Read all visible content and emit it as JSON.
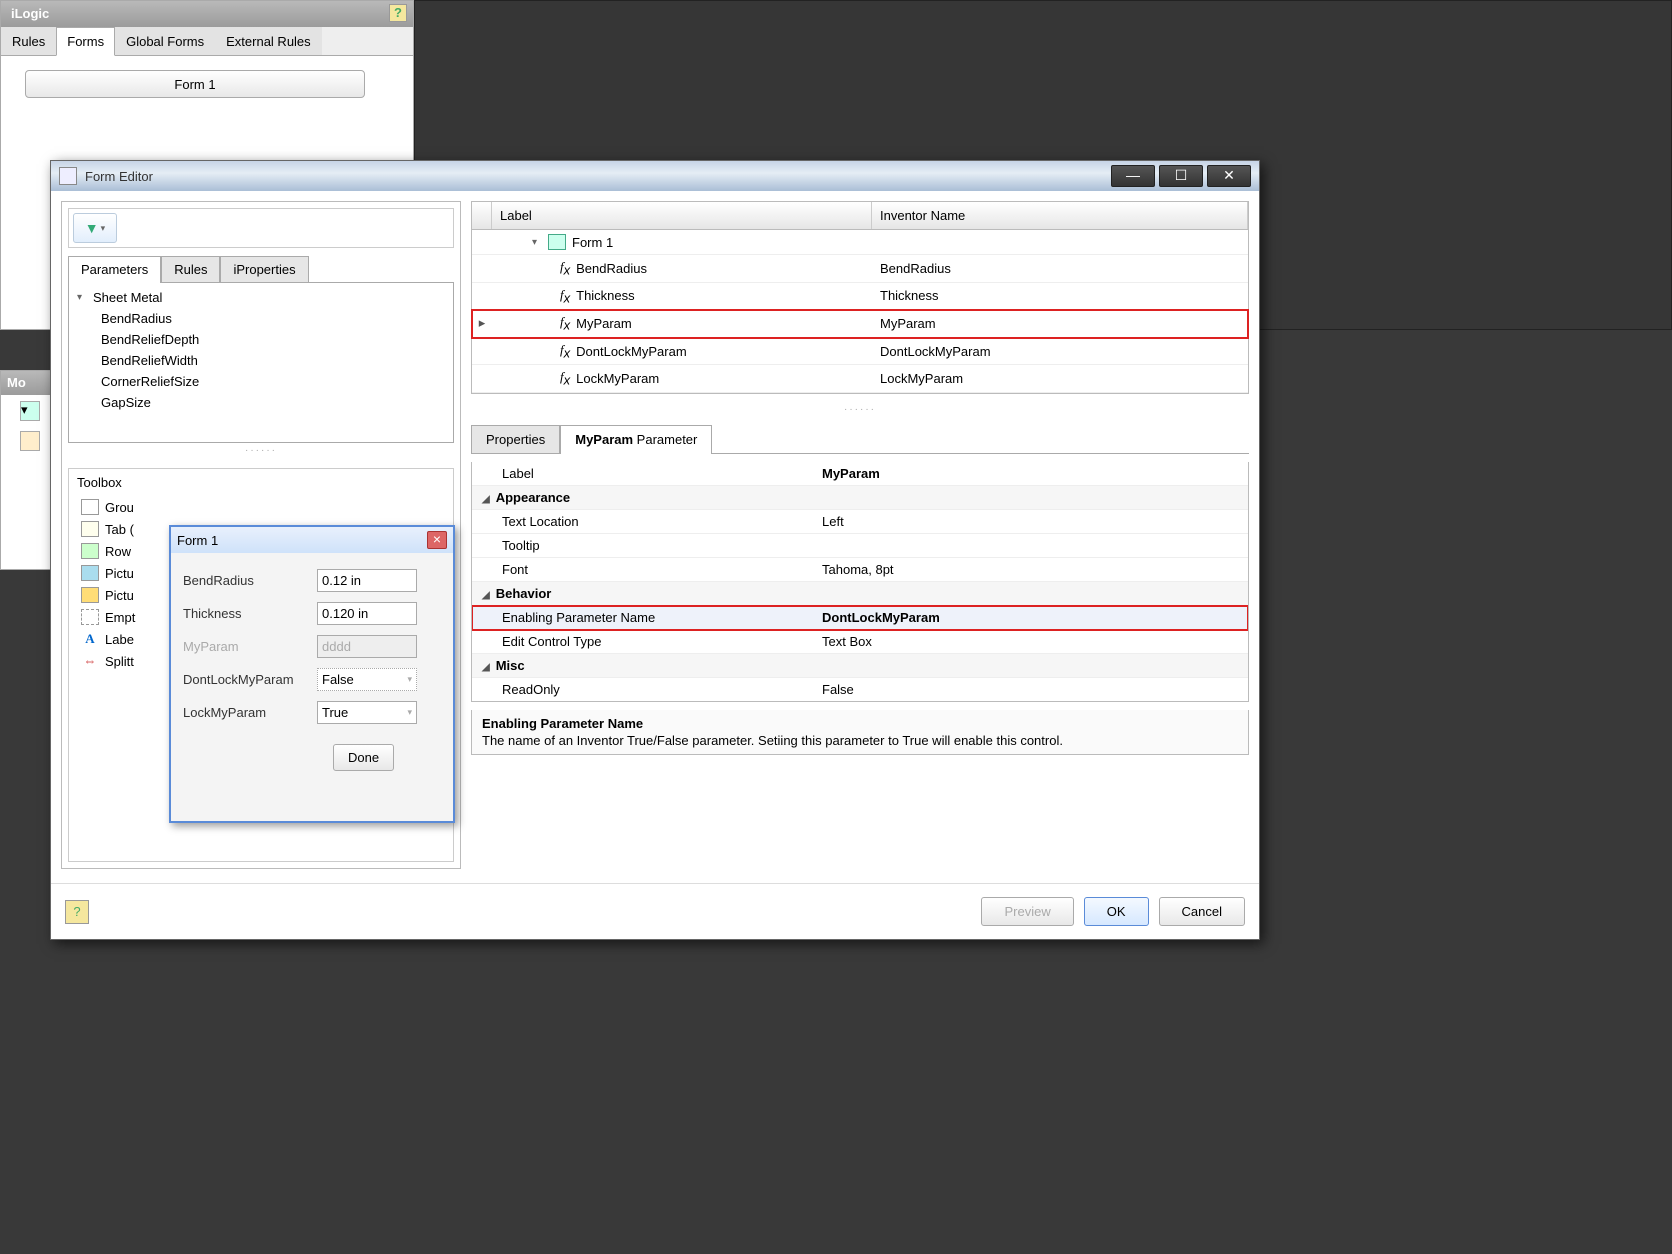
{
  "ilogic": {
    "title": "iLogic",
    "tabs": [
      "Rules",
      "Forms",
      "Global Forms",
      "External Rules"
    ],
    "active_tab": "Forms",
    "form_button": "Form 1"
  },
  "behind": {
    "title": "Mo"
  },
  "editor": {
    "title": "Form Editor",
    "left": {
      "tabs": [
        "Parameters",
        "Rules",
        "iProperties"
      ],
      "active_tab": "Parameters",
      "tree_root": "Sheet Metal",
      "tree_items": [
        "BendRadius",
        "BendReliefDepth",
        "BendReliefWidth",
        "CornerReliefSize",
        "GapSize"
      ],
      "toolbox_title": "Toolbox",
      "toolbox_items": [
        "Grou",
        "Tab (",
        "Row",
        "Pictu",
        "Pictu",
        "Empt",
        "Labe",
        "Splitt"
      ]
    },
    "tree_table": {
      "headers": [
        "Label",
        "Inventor Name"
      ],
      "form_label": "Form 1",
      "rows": [
        {
          "label": "BendRadius",
          "name": "BendRadius",
          "selected": false
        },
        {
          "label": "Thickness",
          "name": "Thickness",
          "selected": false
        },
        {
          "label": "MyParam",
          "name": "MyParam",
          "selected": true
        },
        {
          "label": "DontLockMyParam",
          "name": "DontLockMyParam",
          "selected": false
        },
        {
          "label": "LockMyParam",
          "name": "LockMyParam",
          "selected": false
        }
      ]
    },
    "prop_tabs": {
      "tab1": "Properties",
      "tab2_prefix": "MyParam",
      "tab2_suffix": " Parameter"
    },
    "props": {
      "label_key": "Label",
      "label_val": "MyParam",
      "cat_appearance": "Appearance",
      "textloc_key": "Text Location",
      "textloc_val": "Left",
      "tooltip_key": "Tooltip",
      "tooltip_val": "",
      "font_key": "Font",
      "font_val": "Tahoma, 8pt",
      "cat_behavior": "Behavior",
      "enabling_key": "Enabling Parameter Name",
      "enabling_val": "DontLockMyParam",
      "edittype_key": "Edit Control Type",
      "edittype_val": "Text Box",
      "cat_misc": "Misc",
      "readonly_key": "ReadOnly",
      "readonly_val": "False"
    },
    "prop_desc": {
      "title": "Enabling Parameter Name",
      "text": "The name of an Inventor True/False parameter.  Setiing this parameter to True will enable this control."
    },
    "footer": {
      "preview": "Preview",
      "ok": "OK",
      "cancel": "Cancel"
    }
  },
  "form1": {
    "title": "Form 1",
    "rows": [
      {
        "label": "BendRadius",
        "value": "0.12 in",
        "type": "text",
        "disabled": false
      },
      {
        "label": "Thickness",
        "value": "0.120 in",
        "type": "text",
        "disabled": false
      },
      {
        "label": "MyParam",
        "value": "dddd",
        "type": "text",
        "disabled": true
      },
      {
        "label": "DontLockMyParam",
        "value": "False",
        "type": "select",
        "disabled": false
      },
      {
        "label": "LockMyParam",
        "value": "True",
        "type": "select",
        "disabled": false
      }
    ],
    "done": "Done"
  }
}
